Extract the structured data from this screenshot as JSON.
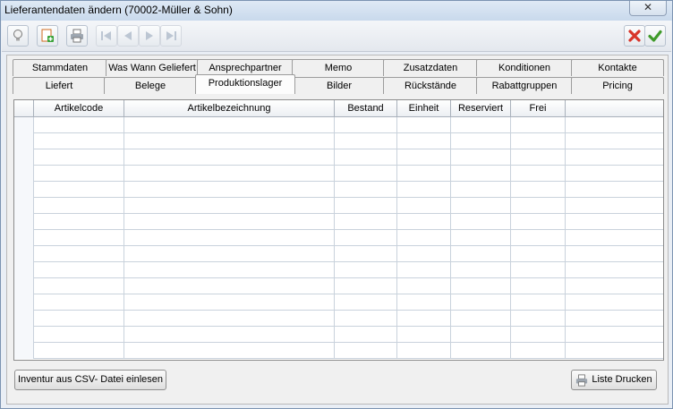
{
  "window": {
    "title": "Lieferantendaten ändern (70002-Müller & Sohn)",
    "close_glyph": "✕"
  },
  "toolbar": {
    "icons": [
      "lightbulb-icon",
      "add-document-icon",
      "print-icon",
      "first-record-icon",
      "previous-record-icon",
      "next-record-icon",
      "last-record-icon",
      "cancel-icon",
      "confirm-icon"
    ],
    "colors": {
      "cancel": "#d8352a",
      "confirm": "#3f9a2a"
    }
  },
  "tabs": {
    "row1": [
      "Stammdaten",
      "Was Wann Geliefert",
      "Ansprechpartner",
      "Memo",
      "Zusatzdaten",
      "Konditionen",
      "Kontakte"
    ],
    "row2": [
      "Liefert",
      "Belege",
      "Produktionslager",
      "Bilder",
      "Rückstände",
      "Rabattgruppen",
      "Pricing"
    ],
    "active": "Produktionslager"
  },
  "grid": {
    "columns": [
      "",
      "Artikelcode",
      "Artikelbezeichnung",
      "Bestand",
      "Einheit",
      "Reserviert",
      "Frei",
      ""
    ],
    "rows": [
      [
        "",
        "",
        "",
        "",
        "",
        "",
        "",
        ""
      ],
      [
        "",
        "",
        "",
        "",
        "",
        "",
        "",
        ""
      ],
      [
        "",
        "",
        "",
        "",
        "",
        "",
        "",
        ""
      ],
      [
        "",
        "",
        "",
        "",
        "",
        "",
        "",
        ""
      ],
      [
        "",
        "",
        "",
        "",
        "",
        "",
        "",
        ""
      ],
      [
        "",
        "",
        "",
        "",
        "",
        "",
        "",
        ""
      ],
      [
        "",
        "",
        "",
        "",
        "",
        "",
        "",
        ""
      ],
      [
        "",
        "",
        "",
        "",
        "",
        "",
        "",
        ""
      ],
      [
        "",
        "",
        "",
        "",
        "",
        "",
        "",
        ""
      ],
      [
        "",
        "",
        "",
        "",
        "",
        "",
        "",
        ""
      ],
      [
        "",
        "",
        "",
        "",
        "",
        "",
        "",
        ""
      ],
      [
        "",
        "",
        "",
        "",
        "",
        "",
        "",
        ""
      ],
      [
        "",
        "",
        "",
        "",
        "",
        "",
        "",
        ""
      ],
      [
        "",
        "",
        "",
        "",
        "",
        "",
        "",
        ""
      ],
      [
        "",
        "",
        "",
        "",
        "",
        "",
        "",
        ""
      ]
    ]
  },
  "buttons": {
    "import_csv": "Inventur aus CSV- Datei einlesen",
    "print_list": "Liste Drucken"
  }
}
